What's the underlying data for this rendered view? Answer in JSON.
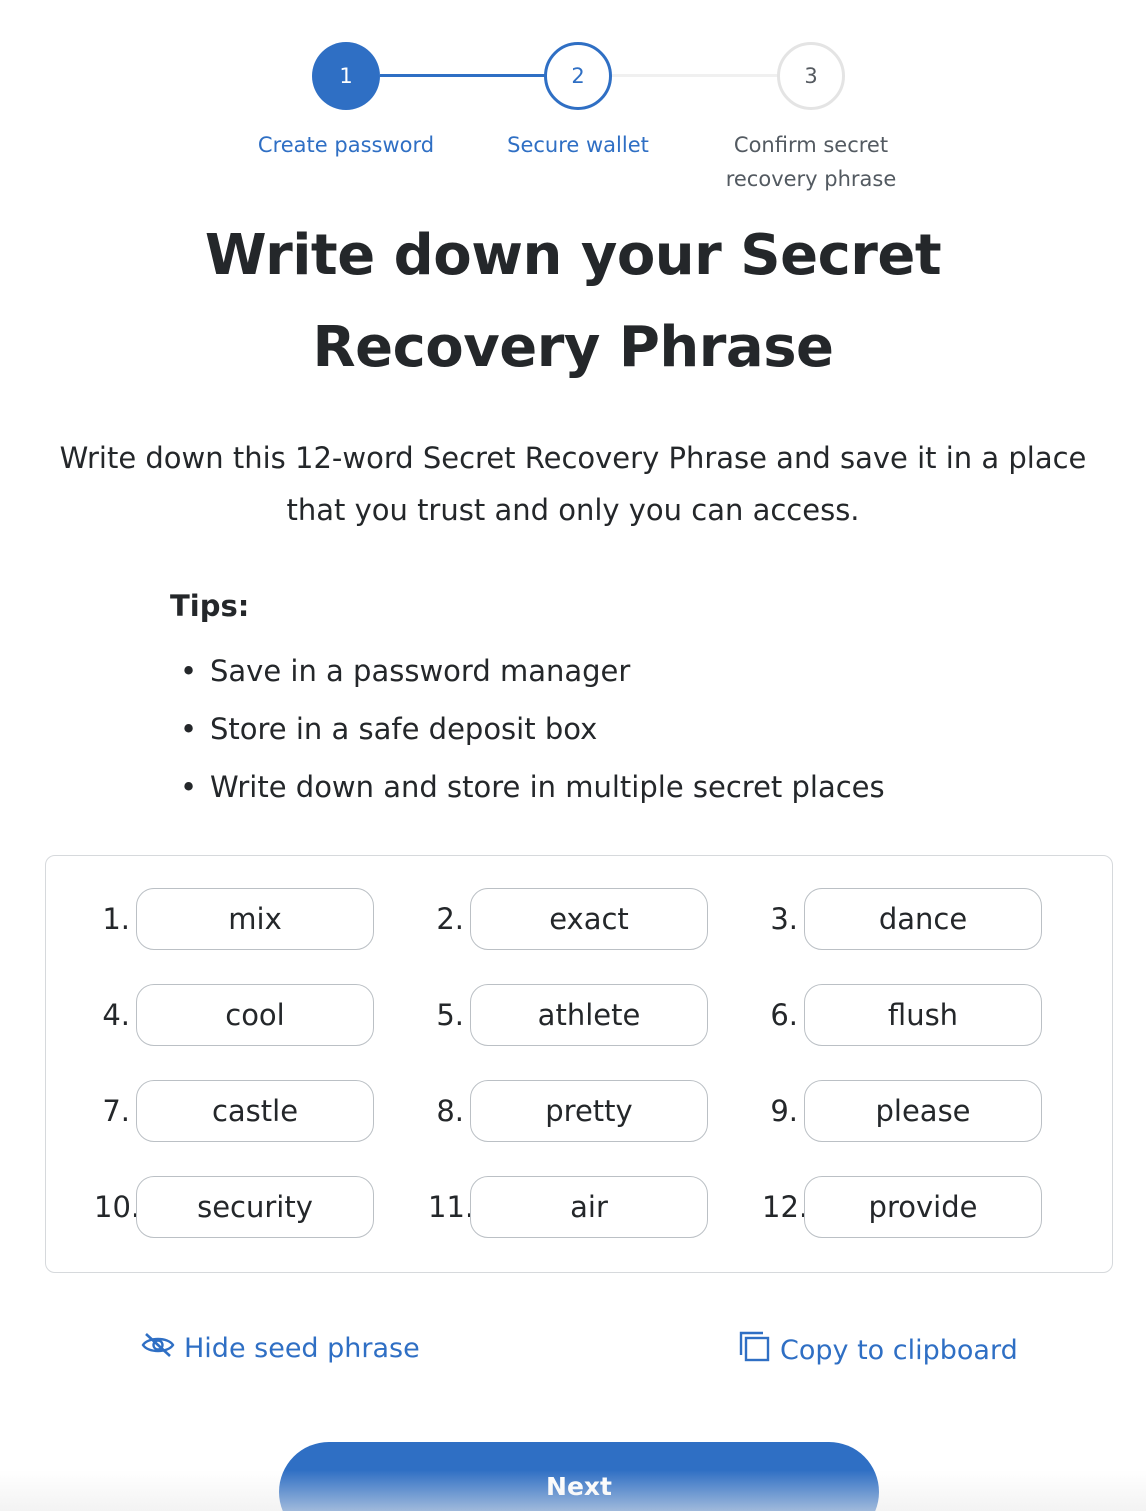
{
  "stepper": {
    "steps": [
      {
        "number": "1",
        "label": "Create password",
        "state": "complete"
      },
      {
        "number": "2",
        "label": "Secure wallet",
        "state": "active"
      },
      {
        "number": "3",
        "label": "Confirm secret recovery phrase",
        "state": "upcoming"
      }
    ]
  },
  "title": "Write down your Secret Recovery Phrase",
  "subtitle": "Write down this 12-word Secret Recovery Phrase and save it in a place that you trust and only you can access.",
  "tips": {
    "heading": "Tips:",
    "items": [
      "Save in a password manager",
      "Store in a safe deposit box",
      "Write down and store in multiple secret places"
    ]
  },
  "phrase": [
    {
      "num": "1.",
      "word": "mix"
    },
    {
      "num": "2.",
      "word": "exact"
    },
    {
      "num": "3.",
      "word": "dance"
    },
    {
      "num": "4.",
      "word": "cool"
    },
    {
      "num": "5.",
      "word": "athlete"
    },
    {
      "num": "6.",
      "word": "flush"
    },
    {
      "num": "7.",
      "word": "castle"
    },
    {
      "num": "8.",
      "word": "pretty"
    },
    {
      "num": "9.",
      "word": "please"
    },
    {
      "num": "10.",
      "word": "security"
    },
    {
      "num": "11.",
      "word": "air"
    },
    {
      "num": "12.",
      "word": "provide"
    }
  ],
  "actions": {
    "hide_label": "Hide seed phrase",
    "hide_icon": "eye-slash-icon",
    "copy_label": "Copy to clipboard",
    "copy_icon": "copy-icon"
  },
  "next_label": "Next",
  "colors": {
    "primary": "#2f6fc4",
    "text": "#24272a",
    "border": "#bbc0c5"
  }
}
